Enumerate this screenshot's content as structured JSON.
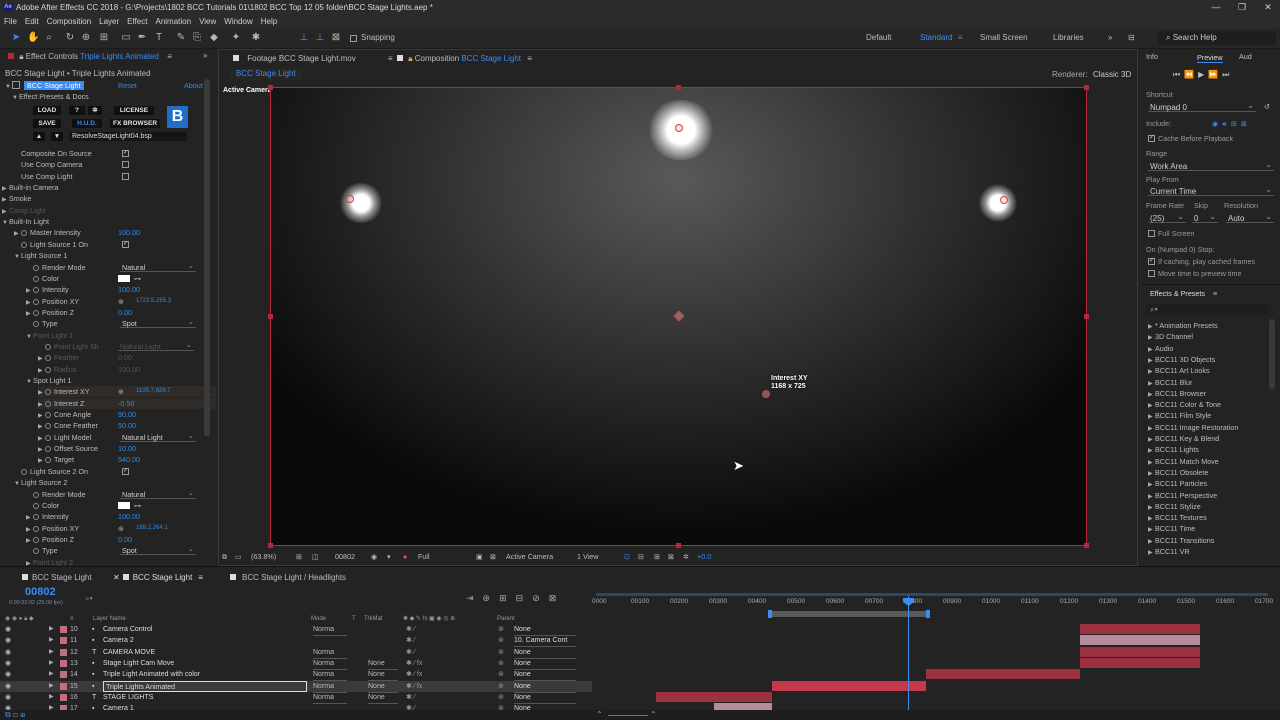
{
  "window": {
    "title": "Adobe After Effects CC 2018 - G:\\Projects\\1802 BCC Tutorials 01\\1802 BCC Top 12 05 folder\\BCC Stage Lights.aep *",
    "app_icon": "Ae"
  },
  "menu": [
    "File",
    "Edit",
    "Composition",
    "Layer",
    "Effect",
    "Animation",
    "View",
    "Window",
    "Help"
  ],
  "toolbar": {
    "snapping": "Snapping",
    "workspaces": [
      "Default",
      "Standard",
      "Small Screen",
      "Libraries"
    ],
    "active_workspace": "Standard",
    "search_placeholder": "Search Help"
  },
  "effect_controls": {
    "tab": "Effect Controls",
    "tab_target": "Triple Lights Animated",
    "breadcrumb": "BCC Stage Light • Triple Lights Animated",
    "effect_name": "BCC Stage Light",
    "reset": "Reset",
    "about": "About",
    "presets_label": "Effect Presets & Docs",
    "buttons": {
      "load": "LOAD",
      "help": "?",
      "license": "LICENSE",
      "save": "SAVE",
      "hud": "H.U.D.",
      "browser": "FX BROWSER"
    },
    "preset_file": "ResolveStageLight04.bsp",
    "rows": [
      {
        "label": "Composite On Source",
        "checked": true
      },
      {
        "label": "Use Comp Camera",
        "checked": false
      },
      {
        "label": "Use Comp Light",
        "checked": false
      },
      {
        "label": "Built-in Camera"
      },
      {
        "label": "Smoke"
      },
      {
        "label": "Comp Light"
      },
      {
        "label": "Built-In Light"
      },
      {
        "label": "Master Intensity",
        "value": "100.00"
      },
      {
        "label": "Light Source 1 On",
        "checked": true
      },
      {
        "label": "Light Source 1"
      },
      {
        "label": "Render Mode",
        "value": "Natural"
      },
      {
        "label": "Color"
      },
      {
        "label": "Intensity",
        "value": "100.00"
      },
      {
        "label": "Position XY",
        "value": "1723.5,265.3"
      },
      {
        "label": "Position Z",
        "value": "0.00"
      },
      {
        "label": "Type",
        "value": "Spot"
      },
      {
        "label": "Point Light 1"
      },
      {
        "label": "Point Light Sh",
        "value": "Natural Light"
      },
      {
        "label": "Feather",
        "value": "0.00"
      },
      {
        "label": "Radius",
        "value": "100.00"
      },
      {
        "label": "Spot Light 1"
      },
      {
        "label": "Interest XY",
        "value": "1105.7,829.7"
      },
      {
        "label": "Interest Z",
        "value": "-0.50"
      },
      {
        "label": "Cone Angle",
        "value": "90.00"
      },
      {
        "label": "Cone Feather",
        "value": "50.00"
      },
      {
        "label": "Light Model",
        "value": "Natural Light"
      },
      {
        "label": "Offset Source",
        "value": "10.00"
      },
      {
        "label": "Target",
        "value": "540.00"
      },
      {
        "label": "Light Source 2 On",
        "checked": true
      },
      {
        "label": "Light Source 2"
      },
      {
        "label": "Render Mode",
        "value": "Natural"
      },
      {
        "label": "Color"
      },
      {
        "label": "Intensity",
        "value": "100.00"
      },
      {
        "label": "Position XY",
        "value": "189.2,264.1"
      },
      {
        "label": "Position Z",
        "value": "0.00"
      },
      {
        "label": "Type",
        "value": "Spot"
      },
      {
        "label": "Point Light 2"
      }
    ]
  },
  "comp": {
    "footage_tab": "Footage",
    "footage_name": "BCC Stage Light.mov",
    "comp_tab": "Composition",
    "comp_name": "BCC Stage Light",
    "crumb": "BCC Stage Light",
    "renderer_label": "Renderer:",
    "renderer": "Classic 3D",
    "camera_label": "Active Camera",
    "interest_label": "Interest XY",
    "interest_value": "1168 x 725",
    "bottom": {
      "zoom": "(63.8%)",
      "time": "00802",
      "resolution": "Full",
      "camera": "Active Camera",
      "views": "1 View",
      "exposure": "+0.0"
    }
  },
  "preview": {
    "tabs": [
      "Info",
      "Preview",
      "Aud"
    ],
    "shortcut_label": "Shortcut",
    "shortcut": "Numpad 0",
    "include_label": "Include:",
    "cache": "Cache Before Playback",
    "range_label": "Range",
    "range": "Work Area",
    "play_from_label": "Play From",
    "play_from": "Current Time",
    "frame_rate_label": "Frame Rate",
    "skip_label": "Skip",
    "resolution_label": "Resolution",
    "frame_rate": "(25)",
    "skip": "0",
    "resolution": "Auto",
    "full_screen": "Full Screen",
    "stop_label": "On (Numpad 0) Stop:",
    "cached": "If caching, play cached frames",
    "move_time": "Move time to preview time"
  },
  "effects_presets": {
    "title": "Effects & Presets",
    "items": [
      "* Animation Presets",
      "3D Channel",
      "Audio",
      "BCC11 3D Objects",
      "BCC11 Art Looks",
      "BCC11 Blur",
      "BCC11 Browser",
      "BCC11 Color & Tone",
      "BCC11 Film Style",
      "BCC11 Image Restoration",
      "BCC11 Key & Blend",
      "BCC11 Lights",
      "BCC11 Match Move",
      "BCC11 Obsolete",
      "BCC11 Particles",
      "BCC11 Perspective",
      "BCC11 Stylize",
      "BCC11 Textures",
      "BCC11 Time",
      "BCC11 Transitions",
      "BCC11 VR"
    ]
  },
  "timeline": {
    "tabs": [
      "BCC Stage Light",
      "BCC Stage Light",
      "BCC Stage Light / Headlights"
    ],
    "timecode": "00802",
    "timecode_sub": "0:00:32:02 (25.00 fps)",
    "col_headers": {
      "layer": "Layer Name",
      "mode": "Mode",
      "t": "T",
      "trkmat": "TrkMat",
      "parent": "Parent"
    },
    "ruler": [
      "0000",
      "00100",
      "00200",
      "00300",
      "00400",
      "00500",
      "00600",
      "00700",
      "00800",
      "00900",
      "01000",
      "01100",
      "01200",
      "01300",
      "01400",
      "01500",
      "01600",
      "01700"
    ],
    "layers": [
      {
        "num": "10",
        "name": "Camera Control",
        "mode": "Norma",
        "trk": "",
        "parent": "None"
      },
      {
        "num": "11",
        "name": "Camera 2",
        "mode": "",
        "trk": "",
        "parent": "10. Camera Cont"
      },
      {
        "num": "12",
        "name": "CAMERA MOVE",
        "mode": "Norma",
        "trk": "",
        "parent": "None"
      },
      {
        "num": "13",
        "name": "Stage Light Cam Move",
        "mode": "Norma",
        "trk": "None",
        "parent": "None"
      },
      {
        "num": "14",
        "name": "Triple Light Animated with color",
        "mode": "Norma",
        "trk": "None",
        "parent": "None"
      },
      {
        "num": "15",
        "name": "Triple Lights Animated",
        "mode": "Norma",
        "trk": "None",
        "parent": "None"
      },
      {
        "num": "16",
        "name": "STAGE LIGHTS",
        "mode": "Norma",
        "trk": "None",
        "parent": "None"
      },
      {
        "num": "17",
        "name": "Camera 1",
        "mode": "",
        "trk": "",
        "parent": "None"
      }
    ]
  }
}
